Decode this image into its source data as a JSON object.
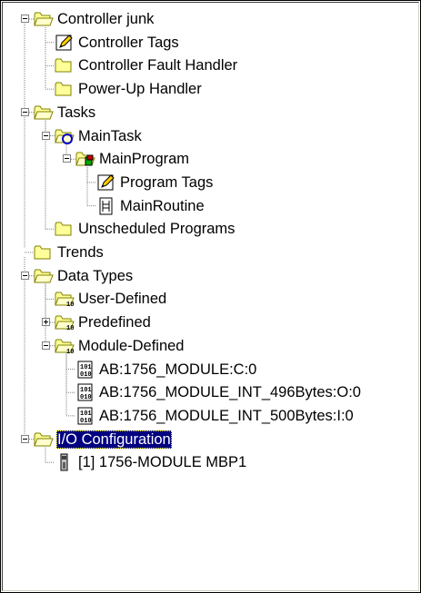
{
  "tree": [
    {
      "label": "Controller junk",
      "level": 0,
      "expander": "minus",
      "icon": "folder-open-icon",
      "children": [
        {
          "label": "Controller Tags",
          "level": 1,
          "icon": "tags-pencil-icon"
        },
        {
          "label": "Controller Fault Handler",
          "level": 1,
          "icon": "folder-icon"
        },
        {
          "label": "Power-Up Handler",
          "level": 1,
          "icon": "folder-icon"
        }
      ]
    },
    {
      "label": "Tasks",
      "level": 0,
      "expander": "minus",
      "icon": "folder-open-icon",
      "children": [
        {
          "label": "MainTask",
          "level": 1,
          "expander": "minus",
          "icon": "task-icon",
          "children": [
            {
              "label": "MainProgram",
              "level": 2,
              "expander": "minus",
              "icon": "program-icon",
              "children": [
                {
                  "label": "Program Tags",
                  "level": 3,
                  "icon": "tags-pencil-icon"
                },
                {
                  "label": "MainRoutine",
                  "level": 3,
                  "icon": "routine-icon"
                }
              ]
            }
          ]
        },
        {
          "label": "Unscheduled Programs",
          "level": 1,
          "icon": "folder-icon"
        }
      ]
    },
    {
      "label": "Trends",
      "level": 0,
      "icon": "folder-icon"
    },
    {
      "label": "Data Types",
      "level": 0,
      "expander": "minus",
      "icon": "folder-open-icon",
      "children": [
        {
          "label": "User-Defined",
          "level": 1,
          "icon": "datatype-folder-icon"
        },
        {
          "label": "Predefined",
          "level": 1,
          "expander": "plus",
          "icon": "datatype-folder-icon"
        },
        {
          "label": "Module-Defined",
          "level": 1,
          "expander": "minus",
          "icon": "datatype-folder-icon",
          "children": [
            {
              "label": "AB:1756_MODULE:C:0",
              "level": 2,
              "icon": "binary-icon"
            },
            {
              "label": "AB:1756_MODULE_INT_496Bytes:O:0",
              "level": 2,
              "icon": "binary-icon"
            },
            {
              "label": "AB:1756_MODULE_INT_500Bytes:I:0",
              "level": 2,
              "icon": "binary-icon"
            }
          ]
        }
      ]
    },
    {
      "label": "I/O Configuration",
      "level": 0,
      "expander": "minus",
      "icon": "folder-open-icon",
      "selected": true,
      "children": [
        {
          "label": "[1] 1756-MODULE MBP1",
          "level": 1,
          "icon": "module-icon"
        }
      ]
    }
  ],
  "colors": {
    "selection_bg": "#000080",
    "selection_text": "#ffffff",
    "folder": "#ffff99",
    "folder_edge": "#808000",
    "tree_lines": "#808080"
  }
}
